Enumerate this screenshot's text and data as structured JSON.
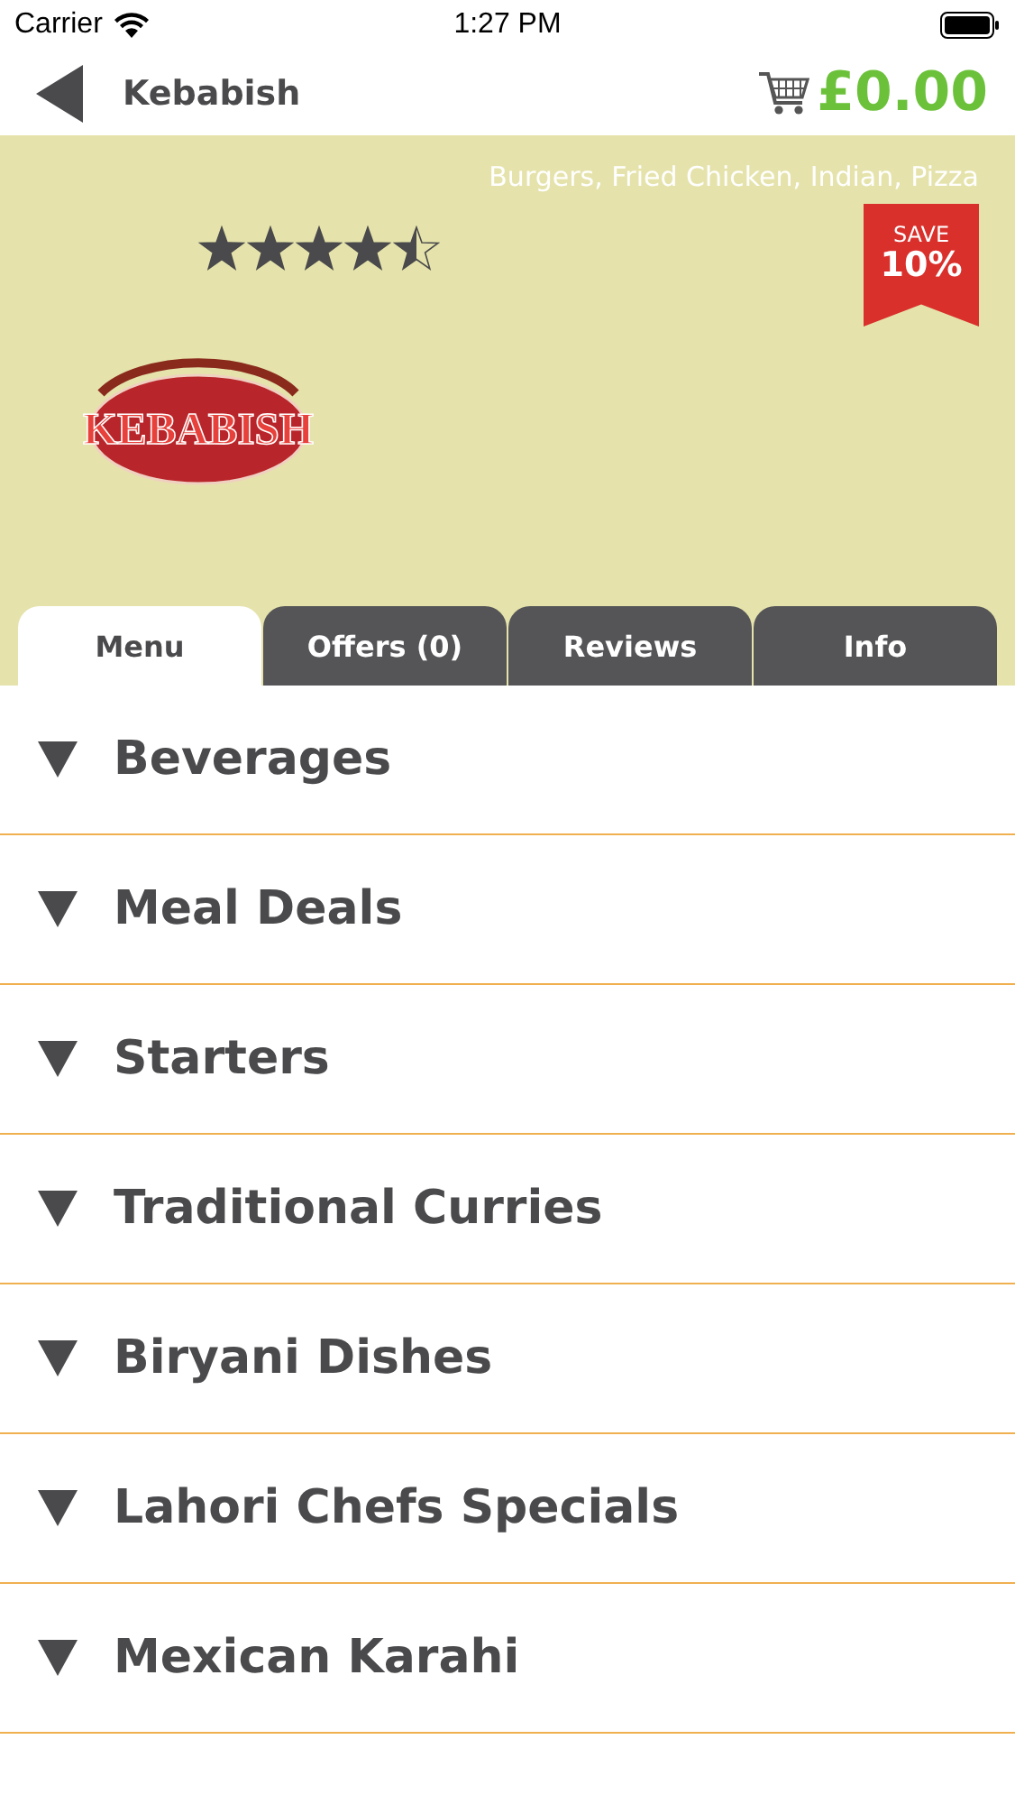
{
  "status_bar": {
    "carrier": "Carrier",
    "time": "1:27 PM"
  },
  "nav": {
    "title": "Kebabish",
    "cart_total": "£0.00"
  },
  "restaurant": {
    "cuisines": "Burgers, Fried Chicken, Indian, Pizza",
    "stars": 4.5,
    "logo_text": "KEBABISH",
    "badge_top": "SAVE",
    "badge_value": "10%"
  },
  "tabs": [
    {
      "label": "Menu",
      "selected": true
    },
    {
      "label": "Offers (0)",
      "selected": false
    },
    {
      "label": "Reviews",
      "selected": false
    },
    {
      "label": "Info",
      "selected": false
    }
  ],
  "categories": [
    {
      "label": "Beverages",
      "expanded": false
    },
    {
      "label": "Meal Deals",
      "expanded": false
    },
    {
      "label": "Starters",
      "expanded": false
    },
    {
      "label": "Traditional Curries",
      "expanded": false
    },
    {
      "label": "Biryani Dishes",
      "expanded": false
    },
    {
      "label": "Lahori Chefs Specials",
      "expanded": false
    },
    {
      "label": "Mexican Karahi",
      "expanded": false
    }
  ]
}
